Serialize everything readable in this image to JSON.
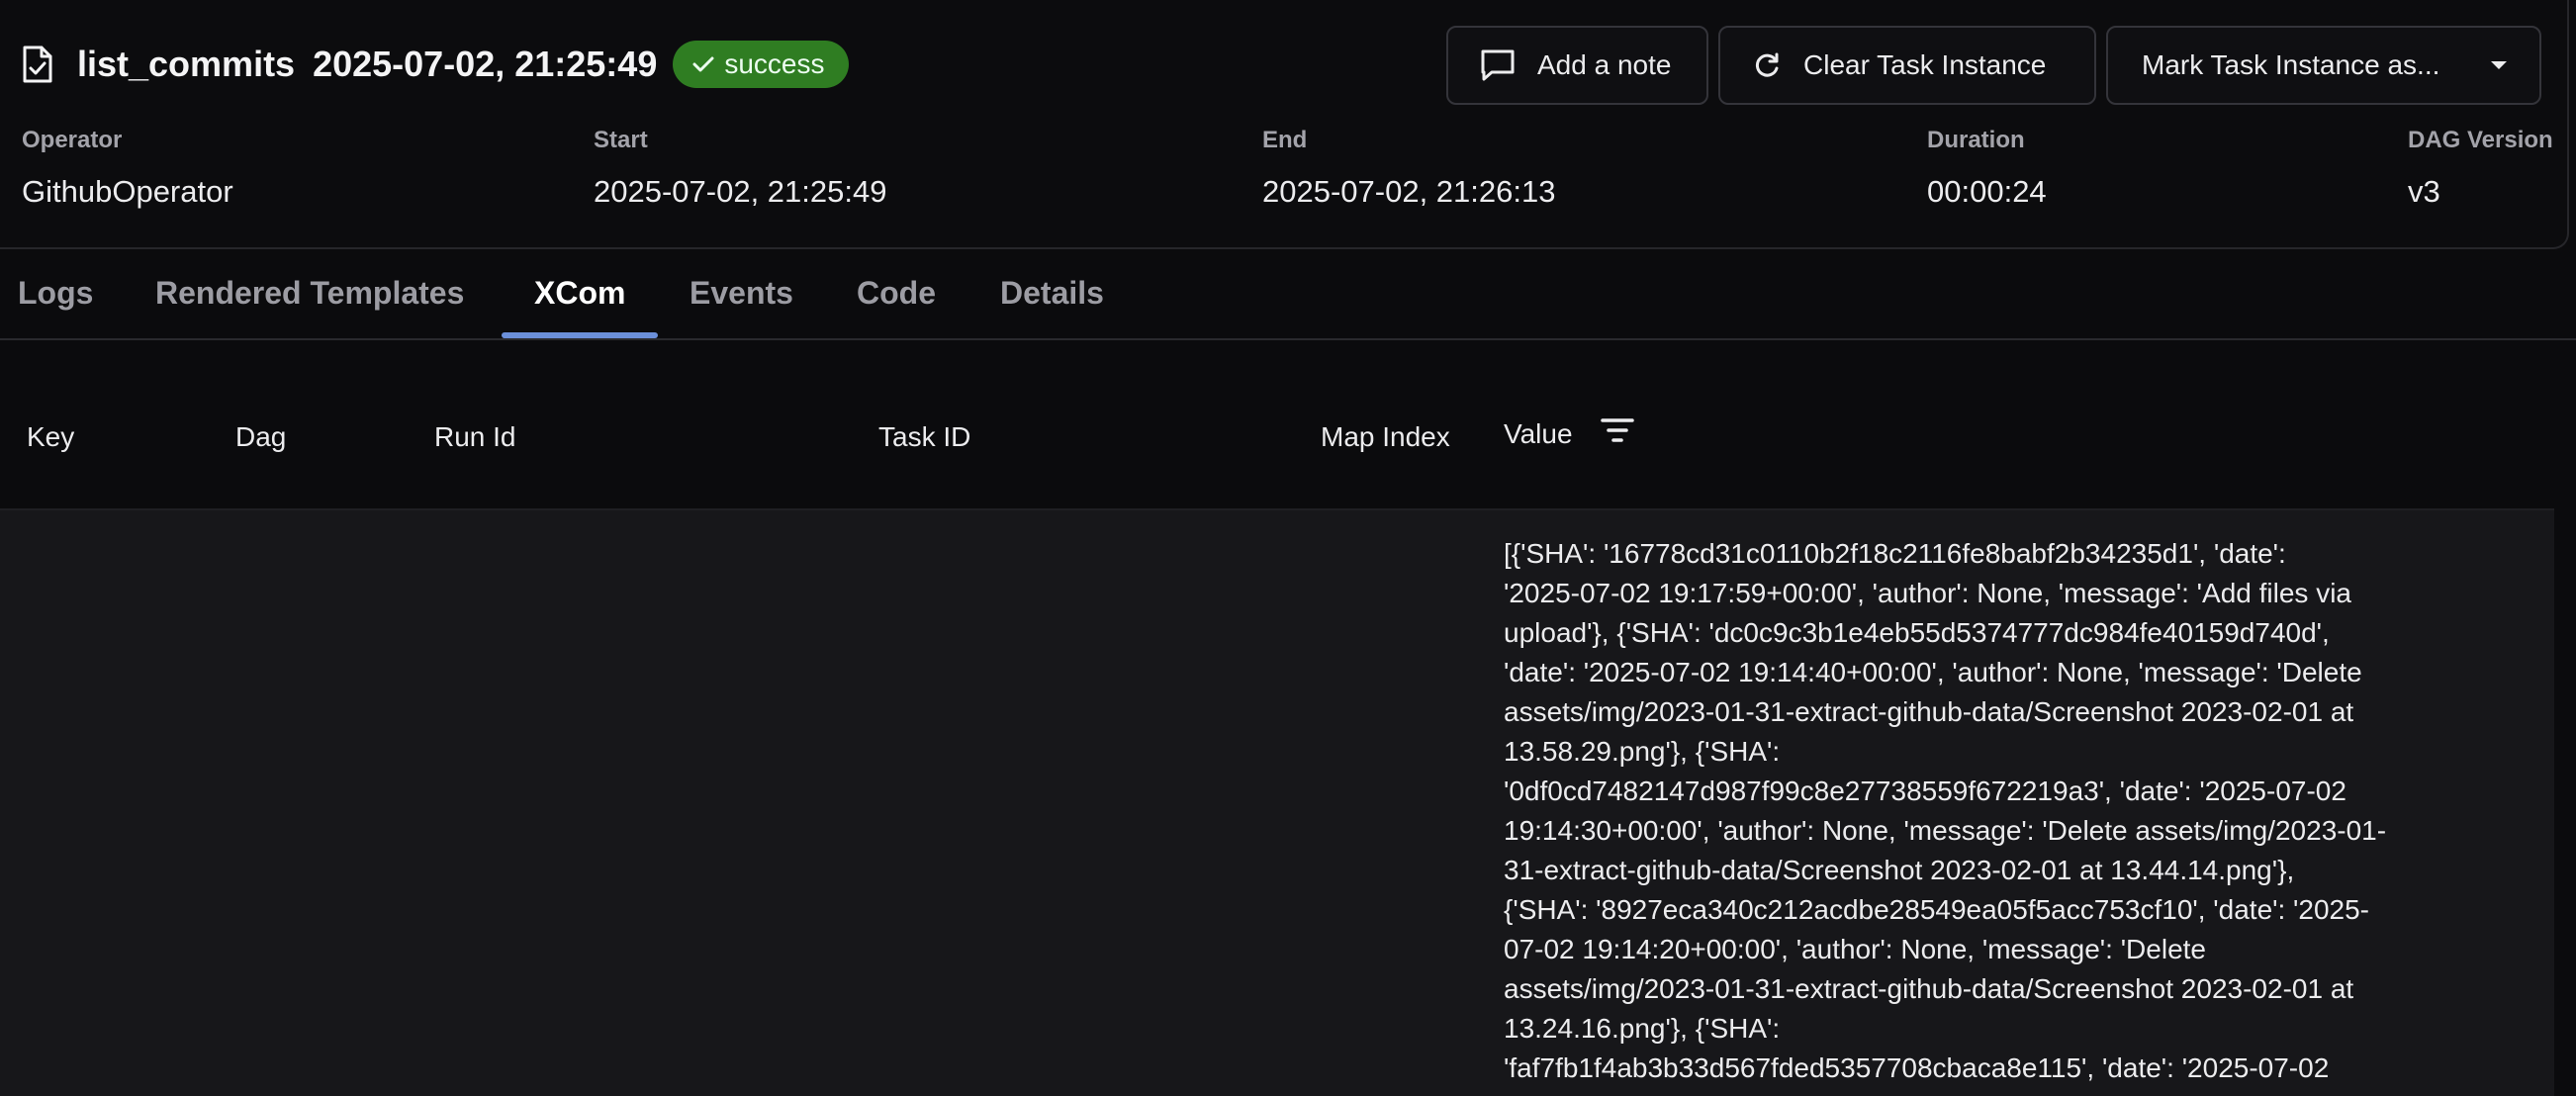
{
  "header": {
    "task_name": "list_commits",
    "task_date": "2025-07-02, 21:25:49",
    "status": "success",
    "actions": {
      "add_note": "Add a note",
      "clear": "Clear Task Instance",
      "mark": "Mark Task Instance as..."
    },
    "meta": {
      "operator_label": "Operator",
      "operator_value": "GithubOperator",
      "start_label": "Start",
      "start_value": "2025-07-02, 21:25:49",
      "end_label": "End",
      "end_value": "2025-07-02, 21:26:13",
      "duration_label": "Duration",
      "duration_value": "00:00:24",
      "dag_version_label": "DAG Version",
      "dag_version_value": "v3"
    }
  },
  "tabs": [
    "Logs",
    "Rendered Templates",
    "XCom",
    "Events",
    "Code",
    "Details"
  ],
  "active_tab": "XCom",
  "table": {
    "columns": {
      "key": "Key",
      "dag": "Dag",
      "run_id": "Run Id",
      "task_id": "Task ID",
      "map_index": "Map Index",
      "value": "Value"
    },
    "value_lines": [
      "[{'SHA': '16778cd31c0110b2f18c2116fe8babf2b34235d1', 'date':",
      "'2025-07-02 19:17:59+00:00', 'author': None, 'message': 'Add files via",
      "upload'}, {'SHA': 'dc0c9c3b1e4eb55d5374777dc984fe40159d740d',",
      "'date': '2025-07-02 19:14:40+00:00', 'author': None, 'message': 'Delete",
      "assets/img/2023-01-31-extract-github-data/Screenshot 2023-02-01 at",
      "13.58.29.png'}, {'SHA':",
      "'0df0cd7482147d987f99c8e27738559f672219a3', 'date': '2025-07-02",
      "19:14:30+00:00', 'author': None, 'message': 'Delete assets/img/2023-01-",
      "31-extract-github-data/Screenshot 2023-02-01 at 13.44.14.png'},",
      "{'SHA': '8927eca340c212acdbe28549ea05f5acc753cf10', 'date': '2025-",
      "07-02 19:14:20+00:00', 'author': None, 'message': 'Delete",
      "assets/img/2023-01-31-extract-github-data/Screenshot 2023-02-01 at",
      "13.24.16.png'}, {'SHA':",
      "'faf7fb1f4ab3b33d567fded5357708cbaca8e115', 'date': '2025-07-02"
    ]
  },
  "icons": {
    "title": "file-check-icon",
    "status": "check-icon",
    "add_note": "message-square-icon",
    "clear": "refresh-icon",
    "mark": "chevron-down-icon",
    "filter": "filter-icon"
  },
  "colors": {
    "status_badge": "#2f7d22",
    "active_tab_underline": "#6b8fd9",
    "background": "#0b0b0d",
    "table_body": "#17171a"
  }
}
